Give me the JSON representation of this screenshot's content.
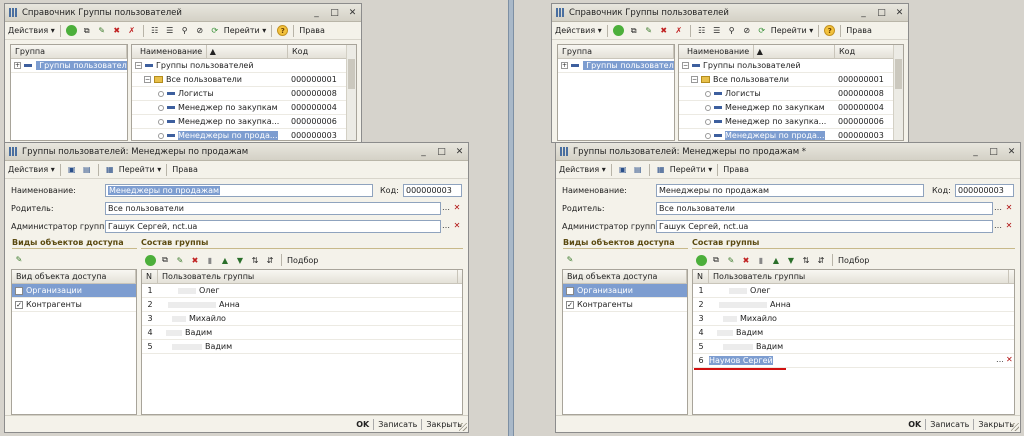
{
  "ref_window": {
    "title": "Справочник Группы пользователей",
    "actions_label": "Действия",
    "goto_label": "Перейти",
    "rights_label": "Права",
    "help_glyph": "?",
    "left_header": "Группа",
    "tree_root": "Группы пользователе",
    "col_name": "Наименование",
    "col_code": "Код",
    "rows": [
      {
        "name": "Группы пользователей",
        "code": ""
      },
      {
        "name": "Все пользователи",
        "code": "000000001"
      },
      {
        "name": "Логисты",
        "code": "000000008"
      },
      {
        "name": "Менеджер по закупкам",
        "code": "000000004"
      },
      {
        "name": "Менеджер по закупка...",
        "code": "000000006"
      },
      {
        "name": "Менеджеры по прода...",
        "code": "000000003"
      }
    ]
  },
  "form_left": {
    "title": "Группы пользователей: Менеджеры по продажам",
    "actions_label": "Действия",
    "goto_label": "Перейти",
    "rights_label": "Права",
    "name_label": "Наименование:",
    "name_value": "Менеджеры по продажам",
    "code_label": "Код:",
    "code_value": "000000003",
    "parent_label": "Родитель:",
    "parent_value": "Все пользователи",
    "admin_label": "Администратор группы:",
    "admin_value": "Гашук Сергей, nct.ua",
    "access_title": "Виды объектов доступа",
    "members_title": "Состав группы",
    "access_header": "Вид объекта доступа",
    "access_items": [
      "Организации",
      "Контрагенты"
    ],
    "pick_label": "Подбор",
    "n_header": "N",
    "user_header": "Пользователь группы",
    "members": [
      {
        "n": "1",
        "name": "Олег"
      },
      {
        "n": "2",
        "name": "Анна"
      },
      {
        "n": "3",
        "name": "Михайло"
      },
      {
        "n": "4",
        "name": "Вадим"
      },
      {
        "n": "5",
        "name": "Вадим"
      }
    ],
    "ok_label": "OK",
    "save_label": "Записать",
    "close_label": "Закрыть"
  },
  "form_right": {
    "title": "Группы пользователей: Менеджеры по продажам *",
    "actions_label": "Действия",
    "goto_label": "Перейти",
    "rights_label": "Права",
    "name_label": "Наименование:",
    "name_value": "Менеджеры по продажам",
    "code_label": "Код:",
    "code_value": "000000003",
    "parent_label": "Родитель:",
    "parent_value": "Все пользователи",
    "admin_label": "Администратор группы:",
    "admin_value": "Гашук Сергей, nct.ua",
    "access_title": "Виды объектов доступа",
    "members_title": "Состав группы",
    "access_header": "Вид объекта доступа",
    "access_items": [
      "Организации",
      "Контрагенты"
    ],
    "pick_label": "Подбор",
    "n_header": "N",
    "user_header": "Пользователь группы",
    "members": [
      {
        "n": "1",
        "name": "Олег"
      },
      {
        "n": "2",
        "name": "Анна"
      },
      {
        "n": "3",
        "name": "Михайло"
      },
      {
        "n": "4",
        "name": "Вадим"
      },
      {
        "n": "5",
        "name": "Вадим"
      },
      {
        "n": "6",
        "name": "Наумов Сергей"
      }
    ],
    "ok_label": "OK",
    "save_label": "Записать",
    "close_label": "Закрыть"
  },
  "colors": {
    "selection": "#7d9dd0",
    "section_title": "#5b4a11",
    "highlight_underline": "#d01010"
  }
}
